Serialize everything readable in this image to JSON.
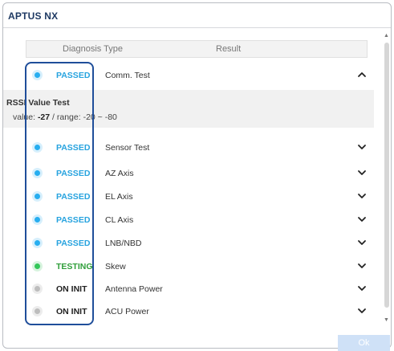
{
  "window": {
    "title": "APTUS NX"
  },
  "table": {
    "header_type": "Diagnosis Type",
    "header_result": "Result"
  },
  "expanded_detail": {
    "title": "RSSI Value Test",
    "value_label": "value: ",
    "value": "-27",
    "range_label": " / range: ",
    "range": "-20 ~ -80"
  },
  "rows": [
    {
      "status": "PASSED",
      "status_color": "#27a3df",
      "dot_color": "#27aef0",
      "name": "Comm. Test",
      "chevron": "up"
    },
    {
      "status": "PASSED",
      "status_color": "#27a3df",
      "dot_color": "#27aef0",
      "name": "Sensor Test",
      "chevron": "down"
    },
    {
      "status": "PASSED",
      "status_color": "#27a3df",
      "dot_color": "#27aef0",
      "name": "AZ Axis",
      "chevron": "down"
    },
    {
      "status": "PASSED",
      "status_color": "#27a3df",
      "dot_color": "#27aef0",
      "name": "EL Axis",
      "chevron": "down"
    },
    {
      "status": "PASSED",
      "status_color": "#27a3df",
      "dot_color": "#27aef0",
      "name": "CL Axis",
      "chevron": "down"
    },
    {
      "status": "PASSED",
      "status_color": "#27a3df",
      "dot_color": "#27aef0",
      "name": "LNB/NBD",
      "chevron": "down"
    },
    {
      "status": "TESTING",
      "status_color": "#2f9e3a",
      "dot_color": "#34c759",
      "name": "Skew",
      "chevron": "down"
    },
    {
      "status": "ON INIT",
      "status_color": "#222222",
      "dot_color": "#bdbdbd",
      "name": "Antenna Power",
      "chevron": "down"
    },
    {
      "status": "ON INIT",
      "status_color": "#222222",
      "dot_color": "#bdbdbd",
      "name": "ACU Power",
      "chevron": "down"
    }
  ],
  "footer": {
    "ok_label": "Ok"
  },
  "icons": {
    "expand": "chevron-down-icon",
    "collapse": "chevron-up-icon",
    "status": "status-dot-icon"
  }
}
